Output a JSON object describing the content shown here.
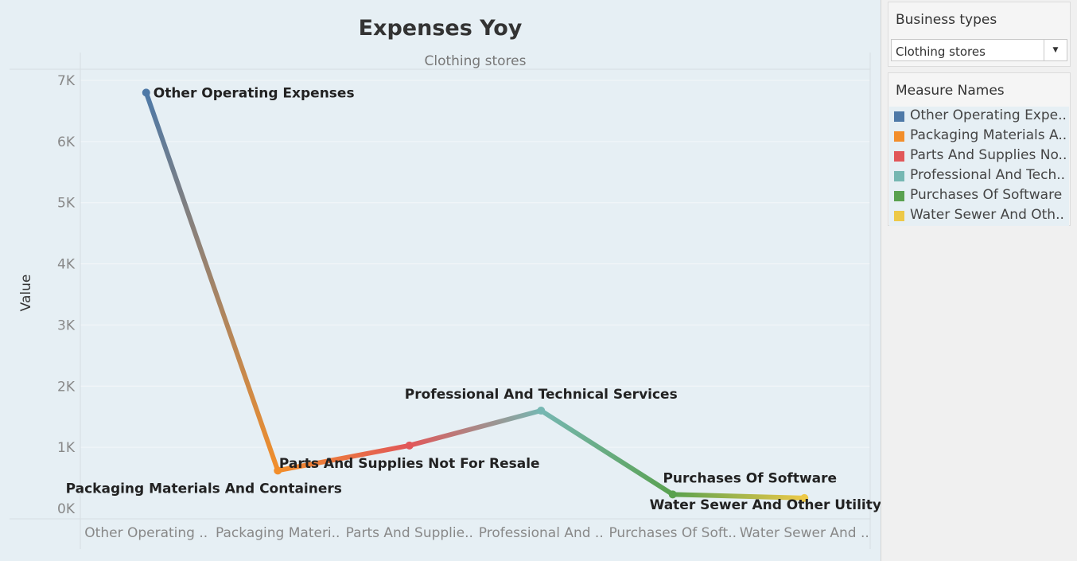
{
  "filter": {
    "title": "Business types",
    "selected": "Clothing stores"
  },
  "legend": {
    "title": "Measure Names",
    "items": [
      {
        "label": "Other Operating Expe..",
        "color": "#4e79a7"
      },
      {
        "label": "Packaging Materials A..",
        "color": "#f28e2b"
      },
      {
        "label": "Parts And Supplies No..",
        "color": "#e15759"
      },
      {
        "label": "Professional And Tech..",
        "color": "#76b7b2"
      },
      {
        "label": "Purchases Of Software",
        "color": "#59a14f"
      },
      {
        "label": "Water Sewer And Oth..",
        "color": "#edc948"
      }
    ]
  },
  "chart_data": {
    "type": "line",
    "title": "Expenses Yoy",
    "panel_header": "Clothing stores",
    "ylabel": "Value",
    "ylim": [
      -150,
      7200
    ],
    "yticks": [
      0,
      1000,
      2000,
      3000,
      4000,
      5000,
      6000,
      7000
    ],
    "ytick_labels": [
      "0K",
      "1K",
      "2K",
      "3K",
      "4K",
      "5K",
      "6K",
      "7K"
    ],
    "categories": [
      "Other Operating ..",
      "Packaging Materi..",
      "Parts And Supplie..",
      "Professional And ..",
      "Purchases Of Soft..",
      "Water Sewer And .."
    ],
    "values": [
      6800,
      620,
      1030,
      1600,
      230,
      170
    ],
    "colors": [
      "#4e79a7",
      "#f28e2b",
      "#e15759",
      "#76b7b2",
      "#59a14f",
      "#edc948"
    ],
    "mark_labels": [
      "Other Operating Expenses",
      "Packaging Materials And Containers",
      "Parts And Supplies Not For Resale",
      "Professional And Technical Services",
      "Purchases Of Software",
      "Water Sewer And Other Utility"
    ],
    "grid": true
  }
}
